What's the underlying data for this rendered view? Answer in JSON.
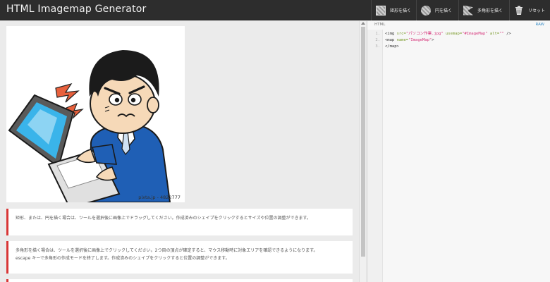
{
  "app": {
    "title": "HTML Imagemap Generator"
  },
  "toolbar": {
    "rect_label": "矩形を描く",
    "circle_label": "円を描く",
    "poly_label": "多角形を描く",
    "reset_label": "リセット"
  },
  "image": {
    "watermark": "pixta.jp - 4822777"
  },
  "help": [
    {
      "lines": [
        "矩形、または、円を描く場合は、ツールを選択後に画像上でドラッグしてください。作成済みのシェイプをクリックするとサイズや位置の調整ができます。"
      ]
    },
    {
      "lines": [
        "多角形を描く場合は、ツールを選択後に画像上でクリックしてください。2つ目の頂点が確定すると、マウス移動時に対象エリアを確認できるようになります。",
        "escape キーで多角形の作成モードを終了します。作成済みのシェイプをクリックすると位置の調整ができます。"
      ]
    }
  ],
  "code": {
    "header_label": "HTML",
    "raw_label": "RAW",
    "line_numbers": [
      "1.",
      "2.",
      "3."
    ],
    "line1": {
      "open": "<img ",
      "a1": "src=",
      "v1": "\"パソコン作業.jpg\"",
      "a2": " usemap=",
      "v2": "\"#ImageMap\"",
      "a3": " alt=",
      "v3": "\"\"",
      "close": " />"
    },
    "line2": {
      "open": "<map ",
      "a1": "name=",
      "v1": "\"ImageMap\"",
      "close": ">"
    },
    "line3": {
      "text": "</map>"
    }
  },
  "colors": {
    "topbar": "#2d2d2d",
    "accent_red": "#d83636",
    "link_blue": "#3a8ec8"
  }
}
